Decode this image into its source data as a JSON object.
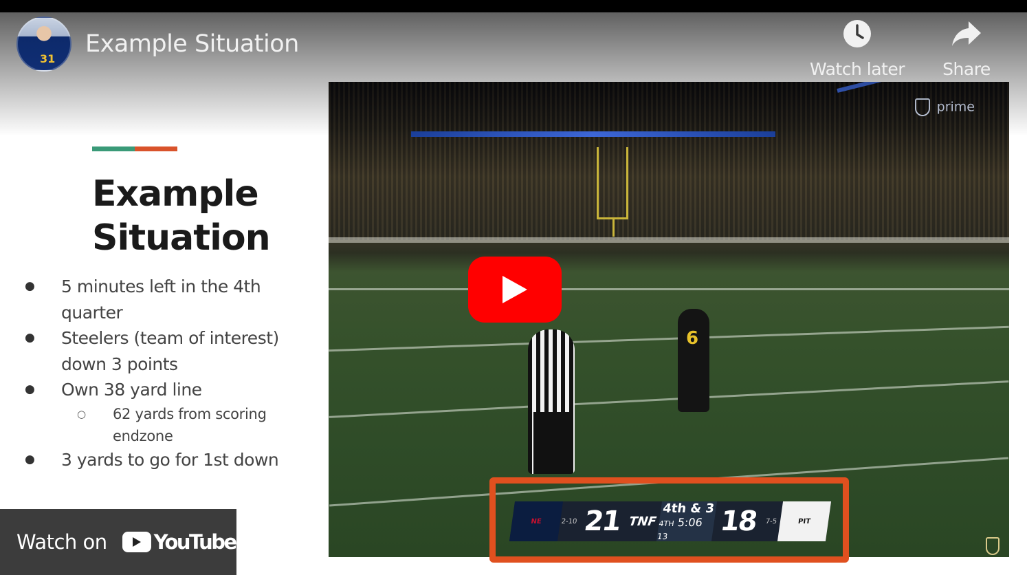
{
  "header": {
    "title": "Example Situation",
    "avatar_number": "31",
    "watch_later_label": "Watch later",
    "share_label": "Share"
  },
  "slide": {
    "accent_colors": [
      "#3a9a78",
      "#d9532b"
    ],
    "title_line1": "Example",
    "title_line2": "Situation",
    "bullets": [
      "5 minutes left in the 4th quarter",
      "Steelers (team of interest) down 3 points",
      "Own 38 yard line",
      "3 yards to go for 1st down"
    ],
    "sub_bullet": "62 yards from scoring endzone"
  },
  "video": {
    "broadcast_brand": "prime",
    "player_number": "6",
    "scorebug": {
      "away_score": "21",
      "away_record": "2-10",
      "network": "TNF",
      "down_distance": "4th & 3",
      "quarter": "4TH",
      "clock": "5:06",
      "play_clock": "13",
      "home_score": "18",
      "home_record": "7-5"
    }
  },
  "footer": {
    "watch_on_label": "Watch on",
    "youtube_label": "YouTube"
  },
  "colors": {
    "play_button": "#ff0000",
    "highlight_box": "#e0501f"
  }
}
